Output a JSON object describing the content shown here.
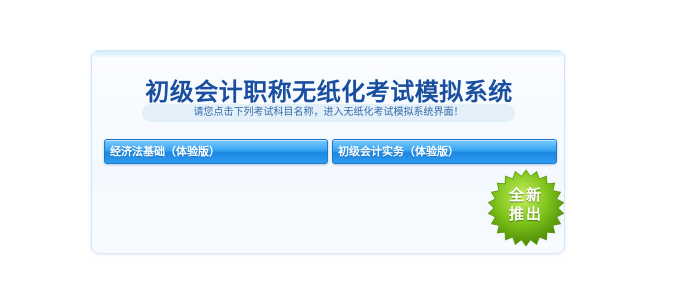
{
  "panel": {
    "title": "初级会计职称无纸化考试模拟系统",
    "hint": "请您点击下列考试科目名称，进入无纸化考试模拟系统界面！"
  },
  "exams": [
    {
      "label": "经济法基础（体验版）"
    },
    {
      "label": "初级会计实务（体验版）"
    }
  ],
  "badge": {
    "line1": "全新",
    "line2": "推出",
    "color": "#7cc21a"
  },
  "colors": {
    "title": "#1a4fa0",
    "button": "#2e9cf2"
  }
}
